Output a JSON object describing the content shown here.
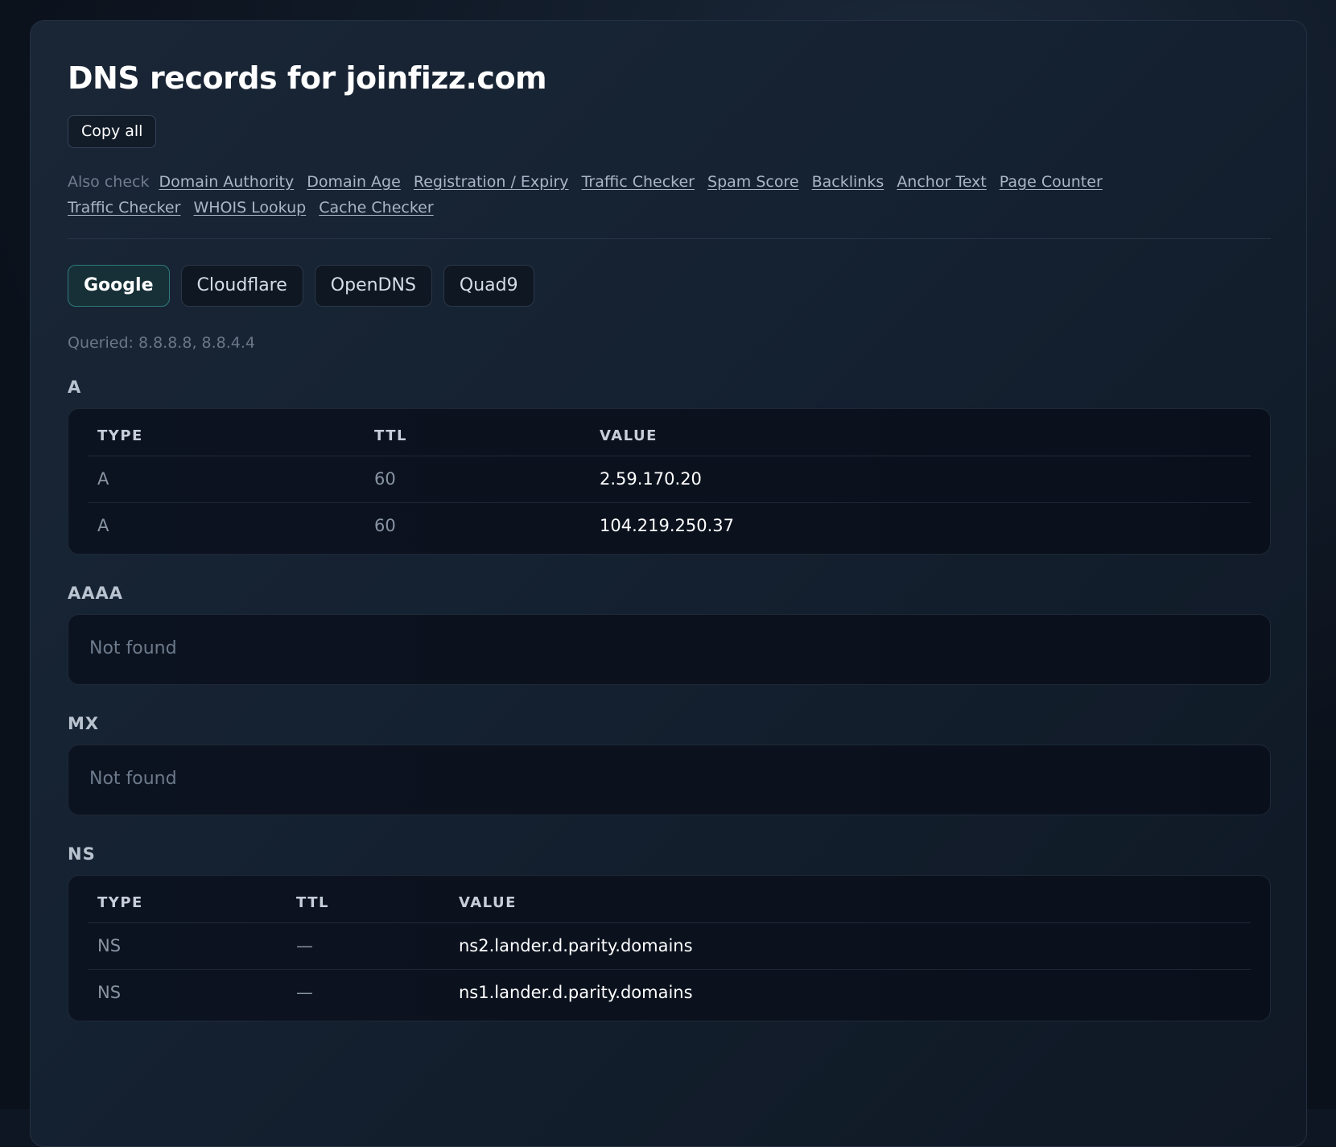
{
  "page": {
    "title": "DNS records for joinfizz.com",
    "copy_all_label": "Copy all",
    "also_check_label": "Also check",
    "also_check_links": [
      "Domain Authority",
      "Domain Age",
      "Registration / Expiry",
      "Traffic Checker",
      "Spam Score",
      "Backlinks",
      "Anchor Text",
      "Page Counter",
      "Traffic Checker",
      "WHOIS Lookup",
      "Cache Checker"
    ],
    "tabs": [
      "Google",
      "Cloudflare",
      "OpenDNS",
      "Quad9"
    ],
    "active_tab": "Google",
    "queried": "Queried: 8.8.8.8, 8.8.4.4"
  },
  "sections": {
    "a": {
      "label": "A",
      "headers": {
        "type": "TYPE",
        "ttl": "TTL",
        "value": "VALUE"
      },
      "rows": [
        {
          "type": "A",
          "ttl": "60",
          "value": "2.59.170.20"
        },
        {
          "type": "A",
          "ttl": "60",
          "value": "104.219.250.37"
        }
      ]
    },
    "aaaa": {
      "label": "AAAA",
      "empty": "Not found"
    },
    "mx": {
      "label": "MX",
      "empty": "Not found"
    },
    "ns": {
      "label": "NS",
      "headers": {
        "type": "TYPE",
        "ttl": "TTL",
        "value": "VALUE"
      },
      "rows": [
        {
          "type": "NS",
          "ttl": "—",
          "value": "ns2.lander.d.parity.domains"
        },
        {
          "type": "NS",
          "ttl": "—",
          "value": "ns1.lander.d.parity.domains"
        }
      ]
    }
  },
  "colors": {
    "accent_tab_border": "#2f7a7a",
    "background": "#0e1624"
  }
}
